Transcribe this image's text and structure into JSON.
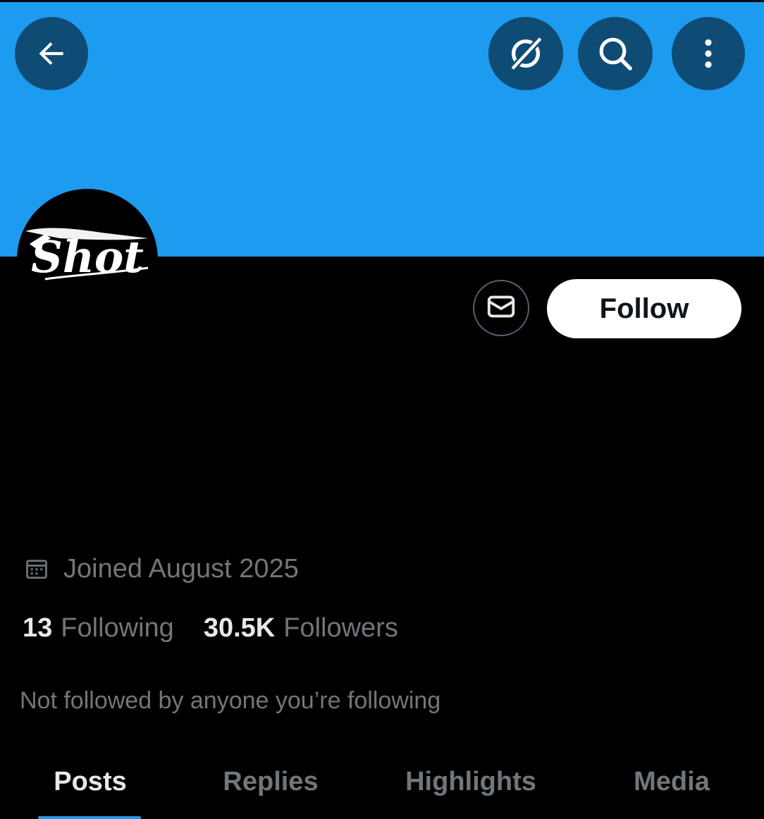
{
  "profile": {
    "avatar_text": "Shot",
    "joined": "Joined August 2025",
    "following_count": "13",
    "following_label": "Following",
    "followers_count": "30.5K",
    "followers_label": "Followers",
    "not_followed": "Not followed by anyone you’re following"
  },
  "actions": {
    "follow_label": "Follow"
  },
  "tabs": [
    {
      "label": "Posts",
      "active": true
    },
    {
      "label": "Replies",
      "active": false
    },
    {
      "label": "Highlights",
      "active": false
    },
    {
      "label": "Media",
      "active": false
    }
  ],
  "colors": {
    "banner": "#1d9bf0",
    "header_button": "#0f4c75",
    "accent": "#1d9bf0",
    "text_primary": "#e7e9ea",
    "text_secondary": "#71767b"
  },
  "icons": {
    "back": "arrow-left-icon",
    "grok": "grok-icon",
    "search": "search-icon",
    "more": "more-vertical-icon",
    "message": "envelope-icon",
    "calendar": "calendar-icon"
  }
}
